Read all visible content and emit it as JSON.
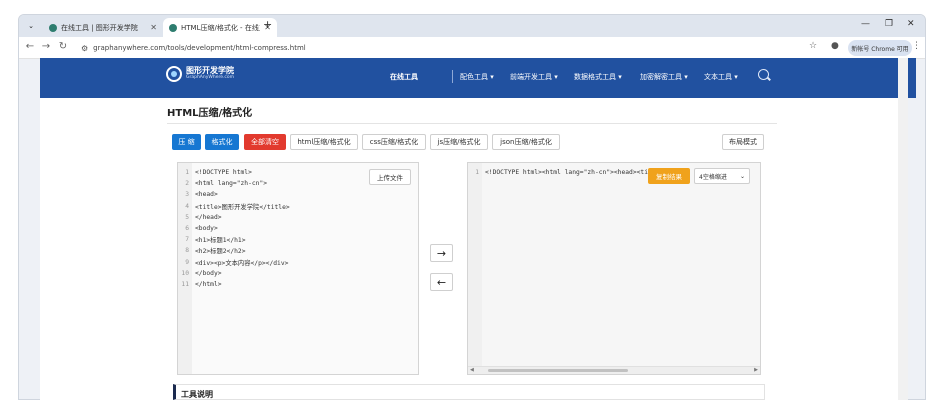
{
  "browser": {
    "tabs": [
      {
        "title": "在线工具 | 图形开发学院"
      },
      {
        "title": "HTML压缩/格式化 - 在线工具 | 图形开发学院"
      }
    ],
    "url": "graphanywhere.com/tools/development/html-compress.html",
    "profile_label": "新帐号 Chrome 可用"
  },
  "site": {
    "logo_name": "图形开发学院",
    "logo_sub": "GraphAnyWhere.com",
    "nav": [
      "在线工具",
      "配色工具 ▾",
      "前端开发工具 ▾",
      "数据格式工具 ▾",
      "加密解密工具 ▾",
      "文本工具 ▾"
    ]
  },
  "page": {
    "title": "HTML压缩/格式化",
    "buttons": {
      "compress": "压 缩",
      "format": "格式化",
      "clear_all": "全部清空",
      "html_tab": "html压缩/格式化",
      "css_tab": "css压缩/格式化",
      "js_tab": "js压缩/格式化",
      "json_tab": "json压缩/格式化",
      "layout": "布局模式"
    },
    "upload_label": "上传文件",
    "copy_label": "复制结果",
    "indent_select": "4空格缩进",
    "tool_desc_title": "工具说明"
  },
  "input_code": [
    {
      "n": "1",
      "code": "<!DOCTYPE html>"
    },
    {
      "n": "2",
      "code": "<html lang=\"zh-cn\">"
    },
    {
      "n": "3",
      "code": "<head>"
    },
    {
      "n": "4",
      "code": "<title>图形开发学院</title>"
    },
    {
      "n": "5",
      "code": "</head>"
    },
    {
      "n": "6",
      "code": "<body>"
    },
    {
      "n": "7",
      "code": "<h1>标题1</h1>"
    },
    {
      "n": "8",
      "code": "<h2>标题2</h2>"
    },
    {
      "n": "9",
      "code": "<div><p>文本内容</p></div>"
    },
    {
      "n": "10",
      "code": "</body>"
    },
    {
      "n": "11",
      "code": "</html>"
    }
  ],
  "output_code": [
    {
      "n": "1",
      "code": "<!DOCTYPE html><html lang=\"zh-cn\"><head><ti"
    }
  ]
}
